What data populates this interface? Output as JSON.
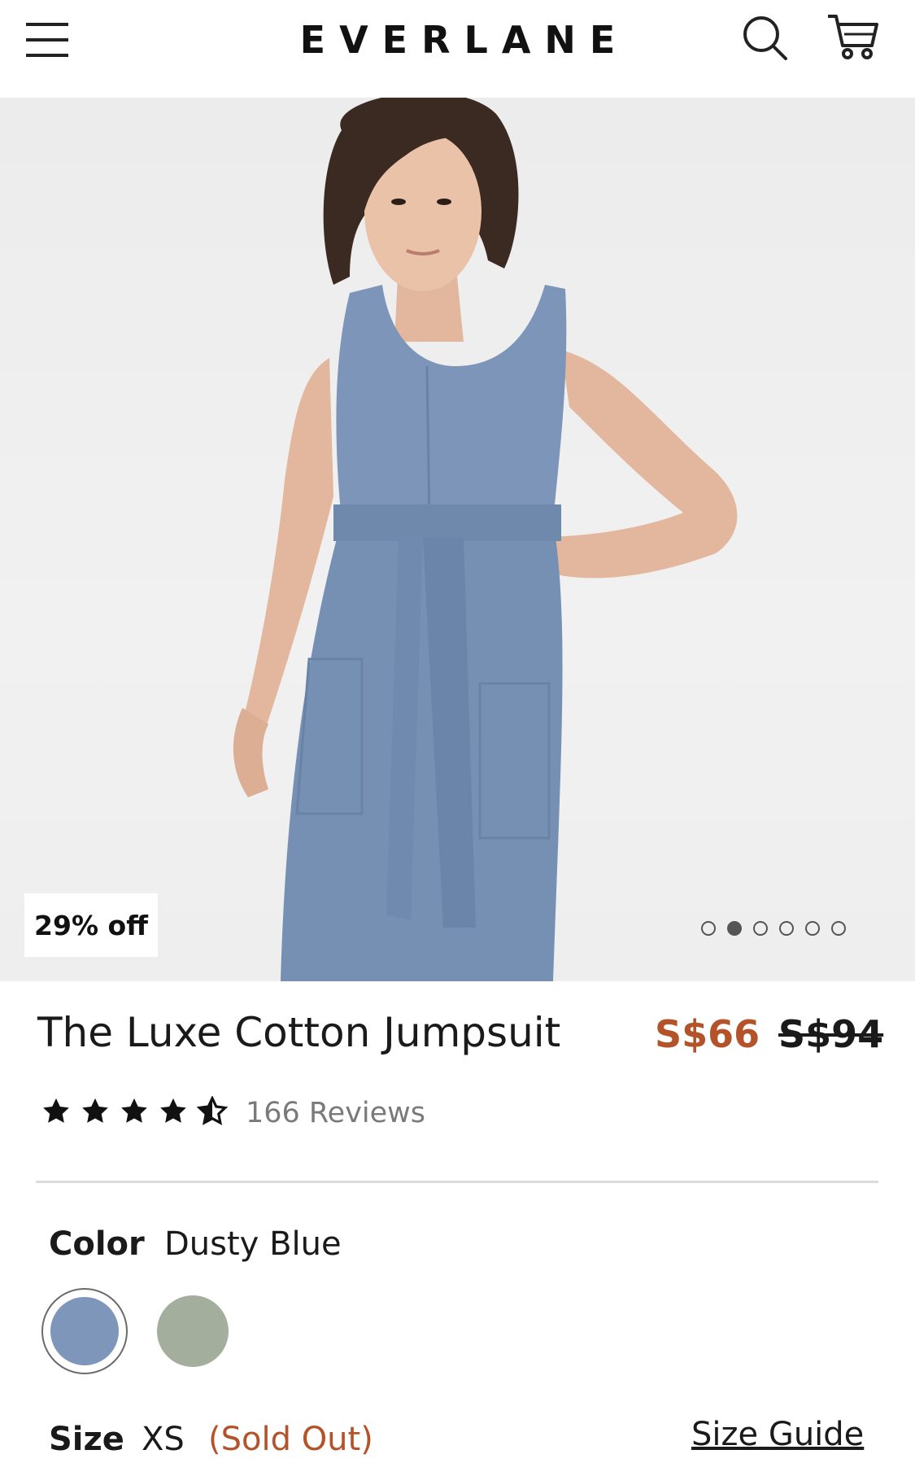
{
  "header": {
    "brand": "EVERLANE",
    "icons": [
      "menu-icon",
      "search-icon",
      "cart-icon"
    ]
  },
  "gallery": {
    "badge": "29% off",
    "image_count": 6,
    "active_index": 1
  },
  "product": {
    "title": "The Luxe Cotton Jumpsuit",
    "sale_price": "S$66",
    "original_price": "S$94",
    "rating": 4.5,
    "reviews_label": "166 Reviews"
  },
  "color": {
    "label": "Color",
    "selected": "Dusty Blue",
    "swatches": [
      "#7d96b9",
      "#a3ae9c"
    ]
  },
  "size": {
    "label": "Size",
    "selected": "XS",
    "status": "(Sold Out)",
    "guide_link": "Size Guide"
  },
  "colors": {
    "accent": "#b4532a",
    "text": "#1a1a1a",
    "muted": "#7a7a7a"
  }
}
